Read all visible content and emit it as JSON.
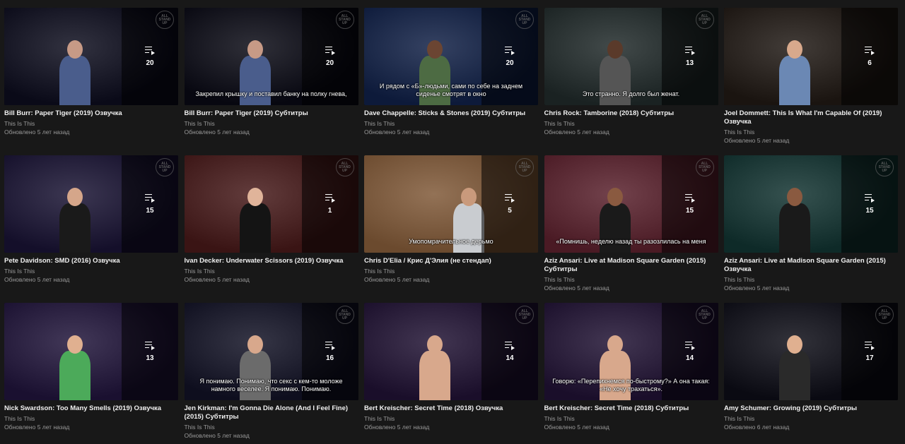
{
  "channel": "This Is This",
  "logo_text": "ALL STAND UP",
  "items": [
    {
      "title": "Bill Burr: Paper Tiger (2019) Озвучка",
      "count": "20",
      "updated": "Обновлено 5 лет назад",
      "subtitle": "",
      "bg": "#0a0a18",
      "shirt": "#4a5d8c",
      "skin": "#c79a86"
    },
    {
      "title": "Bill Burr: Paper Tiger (2019) Субтитры",
      "count": "20",
      "updated": "Обновлено 5 лет назад",
      "subtitle": "Закрепил крышку и поставил банку на полку гнева,",
      "bg": "#070710",
      "shirt": "#4a5d8c",
      "skin": "#c79a86"
    },
    {
      "title": "Dave Chappelle: Sticks & Stones (2019) Субтитры",
      "count": "20",
      "updated": "Обновлено 5 лет назад",
      "subtitle": "И рядом с «Б»-людьми, сами по себе на заднем сиденье смотрят в окно",
      "bg": "#0d1a3a",
      "shirt": "#4d6b43",
      "skin": "#6b4532"
    },
    {
      "title": "Chris Rock: Tamborine (2018) Субтитры",
      "count": "13",
      "updated": "Обновлено 5 лет назад",
      "subtitle": "Это странно. Я долго был женат.",
      "bg": "#1a2222",
      "shirt": "#555555",
      "skin": "#5a3a2a"
    },
    {
      "title": "Joel Dommett: This Is What I'm Capable Of (2019) Озвучка",
      "count": "6",
      "updated": "Обновлено 5 лет назад",
      "subtitle": "",
      "bg": "#1a1410",
      "shirt": "#6b88b4",
      "skin": "#d8a98c"
    },
    {
      "title": "Pete Davidson: SMD (2016) Озвучка",
      "count": "15",
      "updated": "Обновлено 5 лет назад",
      "subtitle": "",
      "bg": "#140f2a",
      "shirt": "#1a1a1a",
      "skin": "#d5a68a"
    },
    {
      "title": "Ivan Decker: Underwater Scissors (2019) Озвучка",
      "count": "1",
      "updated": "Обновлено 5 лет назад",
      "subtitle": "",
      "bg": "#3a1414",
      "shirt": "#141414",
      "skin": "#e0b49a"
    },
    {
      "title": "Chris D'Elia / Крис Д'Элия (не стендап)",
      "count": "5",
      "updated": "Обновлено 5 лет назад",
      "subtitle": "Умопомрачительное дерьмо",
      "bg": "#6b4a2e",
      "shirt": "#c9ccd0",
      "skin": "#c99a7c"
    },
    {
      "title": "Aziz Ansari: Live at Madison Square Garden (2015) Субтитры",
      "count": "15",
      "updated": "Обновлено 5 лет назад",
      "subtitle": "«Помнишь, неделю назад ты разозлилась на меня",
      "bg": "#4a1a24",
      "shirt": "#1a1a1a",
      "skin": "#8a5a40"
    },
    {
      "title": "Aziz Ansari: Live at Madison Square Garden (2015) Озвучка",
      "count": "15",
      "updated": "Обновлено 5 лет назад",
      "subtitle": "",
      "bg": "#0e2a28",
      "shirt": "#1a1a1a",
      "skin": "#8a5a40"
    },
    {
      "title": "Nick Swardson: Too Many Smells (2019) Озвучка",
      "count": "13",
      "updated": "Обновлено 5 лет назад",
      "subtitle": "",
      "bg": "#1a1030",
      "shirt": "#4caa5a",
      "skin": "#e0b090"
    },
    {
      "title": "Jen Kirkman: I'm Gonna Die Alone (And I Feel Fine) (2015) Субтитры",
      "count": "16",
      "updated": "Обновлено 5 лет назад",
      "subtitle": "Я понимаю. Понимаю, что секс с кем-то моложе намного веселее. Я понимаю. Понимаю.",
      "bg": "#0e0e1e",
      "shirt": "#6b6b6b",
      "skin": "#d8a88c"
    },
    {
      "title": "Bert Kreischer: Secret Time (2018) Озвучка",
      "count": "14",
      "updated": "Обновлено 5 лет назад",
      "subtitle": "",
      "bg": "#1a0e2a",
      "shirt": "#d8a88c",
      "skin": "#d8a88c"
    },
    {
      "title": "Bert Kreischer: Secret Time (2018) Субтитры",
      "count": "14",
      "updated": "Обновлено 5 лет назад",
      "subtitle": "Говорю: «Перепихнемся по-быстрому?» А она такая: «Не хочу трахаться».",
      "bg": "#1a0e2a",
      "shirt": "#d8a88c",
      "skin": "#d8a88c"
    },
    {
      "title": "Amy Schumer: Growing (2019) Субтитры",
      "count": "17",
      "updated": "Обновлено 6 лет назад",
      "subtitle": "",
      "bg": "#0a0a12",
      "shirt": "#2a2a2a",
      "skin": "#e0b090"
    }
  ]
}
